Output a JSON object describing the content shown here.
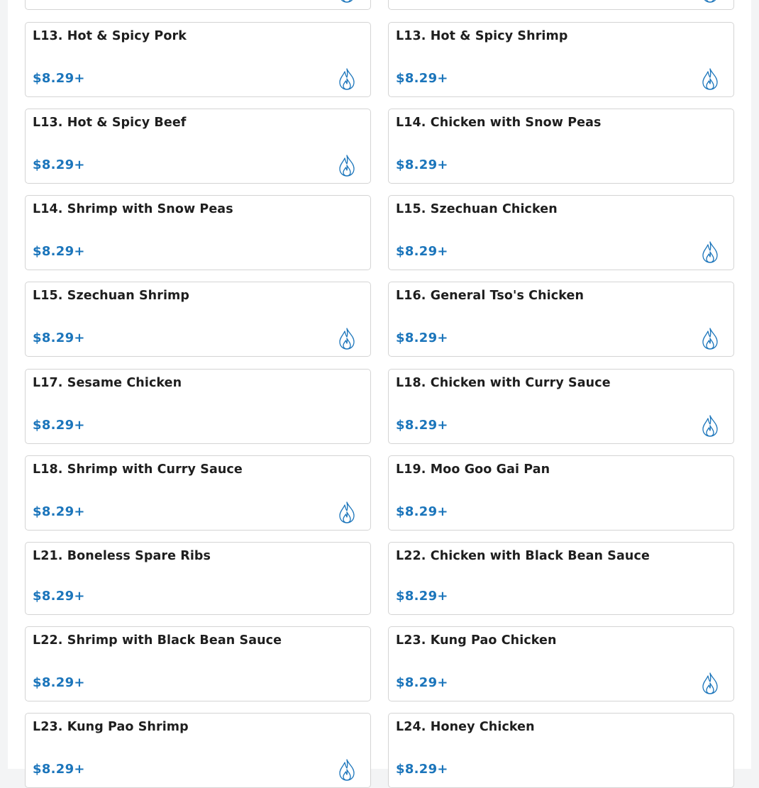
{
  "colors": {
    "price": "#1b75bb",
    "spicy_icon": "#1b75bb",
    "card_border": "#d4d4d4"
  },
  "menu": {
    "items": [
      {
        "name": "",
        "price": "",
        "spicy": true
      },
      {
        "name": "",
        "price": "",
        "spicy": true
      },
      {
        "name": "L13. Hot & Spicy Pork",
        "price": "$8.29+",
        "spicy": true
      },
      {
        "name": "L13. Hot & Spicy Shrimp",
        "price": "$8.29+",
        "spicy": true
      },
      {
        "name": "L13. Hot & Spicy Beef",
        "price": "$8.29+",
        "spicy": true
      },
      {
        "name": "L14. Chicken with Snow Peas",
        "price": "$8.29+",
        "spicy": false
      },
      {
        "name": "L14. Shrimp with Snow Peas",
        "price": "$8.29+",
        "spicy": false
      },
      {
        "name": "L15. Szechuan Chicken",
        "price": "$8.29+",
        "spicy": true
      },
      {
        "name": "L15. Szechuan Shrimp",
        "price": "$8.29+",
        "spicy": true
      },
      {
        "name": "L16. General Tso's Chicken",
        "price": "$8.29+",
        "spicy": true
      },
      {
        "name": "L17. Sesame Chicken",
        "price": "$8.29+",
        "spicy": false
      },
      {
        "name": "L18. Chicken with Curry Sauce",
        "price": "$8.29+",
        "spicy": true
      },
      {
        "name": "L18. Shrimp with Curry Sauce",
        "price": "$8.29+",
        "spicy": true
      },
      {
        "name": "L19. Moo Goo Gai Pan",
        "price": "$8.29+",
        "spicy": false
      },
      {
        "name": "L21. Boneless Spare Ribs",
        "price": "$8.29+",
        "spicy": false
      },
      {
        "name": "L22. Chicken with Black Bean Sauce",
        "price": "$8.29+",
        "spicy": false
      },
      {
        "name": "L22. Shrimp with Black Bean Sauce",
        "price": "$8.29+",
        "spicy": false
      },
      {
        "name": "L23. Kung Pao Chicken",
        "price": "$8.29+",
        "spicy": true
      },
      {
        "name": "L23. Kung Pao Shrimp",
        "price": "$8.29+",
        "spicy": true
      },
      {
        "name": "L24. Honey Chicken",
        "price": "$8.29+",
        "spicy": false
      }
    ]
  }
}
